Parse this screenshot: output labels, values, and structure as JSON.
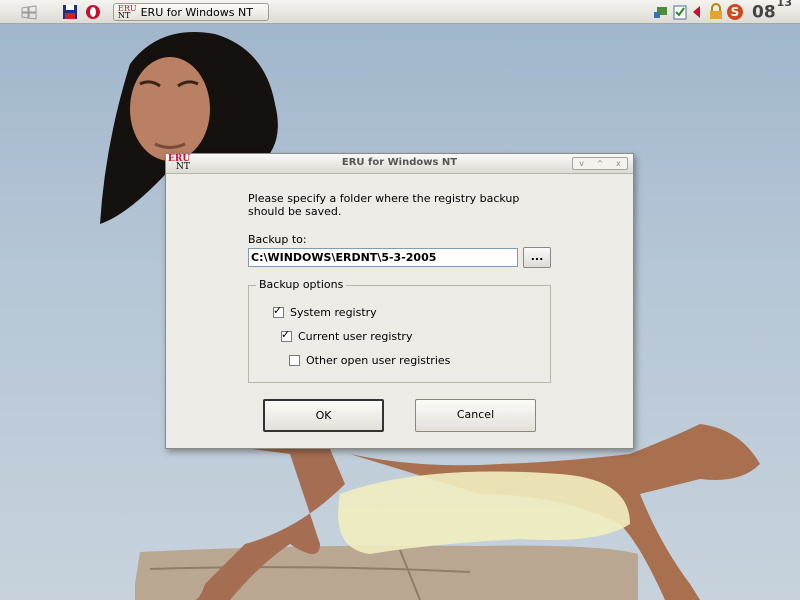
{
  "taskbar": {
    "window_button_label": "ERU for Windows NT",
    "clock_hours": "08",
    "clock_minutes": "13"
  },
  "dialog": {
    "title": "ERU for Windows NT",
    "logo_top": "ERU",
    "logo_bottom": "NT",
    "instruction_line1": "Please specify a folder where the registry backup",
    "instruction_line2": "should be saved.",
    "backup_to_label": "Backup to:",
    "backup_path": "C:\\WINDOWS\\ERDNT\\5-3-2005",
    "browse_label": "...",
    "options_group_label": "Backup options",
    "options": [
      {
        "label": "System registry",
        "checked": true
      },
      {
        "label": "Current user registry",
        "checked": true
      },
      {
        "label": "Other open user registries",
        "checked": false
      }
    ],
    "ok_label": "OK",
    "cancel_label": "Cancel",
    "window_controls": [
      "v",
      "^",
      "x"
    ]
  },
  "colors": {
    "accent_red": "#c8102e",
    "dialog_bg": "#ecebe6",
    "sky": "#b6c6d6"
  },
  "icons": [
    "windows-logo-icon",
    "floppy-save-icon",
    "opera-icon",
    "network-icon",
    "clipboard-icon",
    "volume-icon",
    "lock-icon",
    "s-logo-icon"
  ]
}
